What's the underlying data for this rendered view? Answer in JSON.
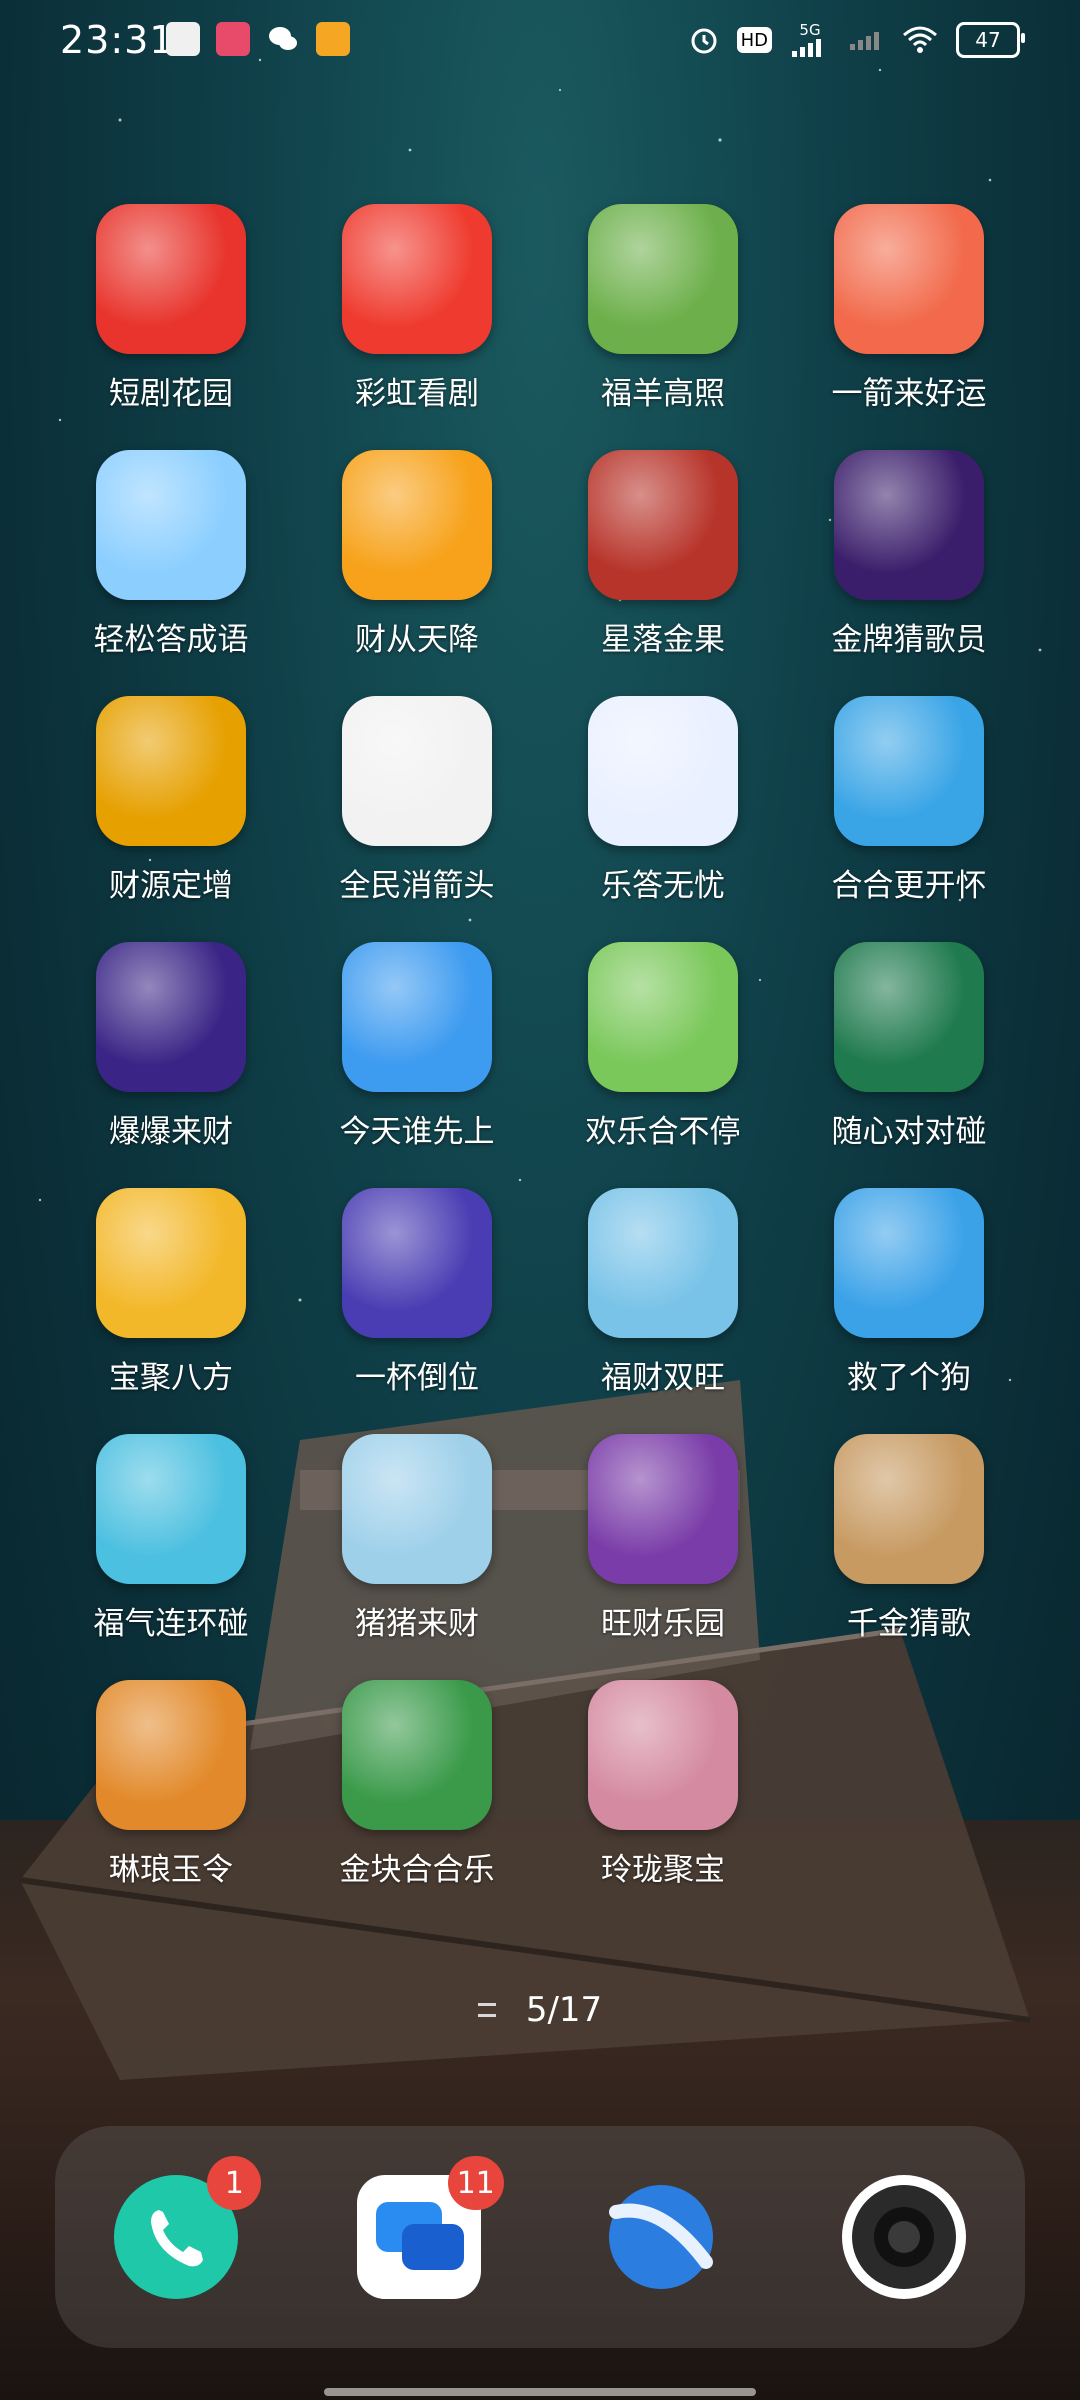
{
  "status_bar": {
    "time": "23:31",
    "battery": "47",
    "network": "5G",
    "hd": "HD"
  },
  "apps": [
    {
      "label": "短剧花园",
      "icon": "short-drama-tv-icon",
      "color": "#e8342c"
    },
    {
      "label": "彩虹看剧",
      "icon": "rainbow-drama-tv-icon",
      "color": "#ef3b2f"
    },
    {
      "label": "福羊高照",
      "icon": "sheep-icon",
      "color": "#6db04b"
    },
    {
      "label": "一箭来好运",
      "icon": "arrow-luck-icon",
      "color": "#f26a4b"
    },
    {
      "label": "轻松答成语",
      "icon": "student-icon",
      "color": "#8ccfff"
    },
    {
      "label": "财从天降",
      "icon": "tiger-icon",
      "color": "#f7a21a"
    },
    {
      "label": "星落金果",
      "icon": "old-man-icon",
      "color": "#b7342a"
    },
    {
      "label": "金牌猜歌员",
      "icon": "vinyl-record-icon",
      "color": "#3b1e6b"
    },
    {
      "label": "财源定增",
      "icon": "green-gem-icon",
      "color": "#e6a000"
    },
    {
      "label": "全民消箭头",
      "icon": "arrow-puzzle-icon",
      "color": "#f2f2f2"
    },
    {
      "label": "乐答无忧",
      "icon": "quiz-clipboard-icon",
      "color": "#e9f0ff"
    },
    {
      "label": "合合更开怀",
      "icon": "watermelon-icon",
      "color": "#3aa5e6"
    },
    {
      "label": "爆爆来财",
      "icon": "heart-balloon-icon",
      "color": "#3a2586"
    },
    {
      "label": "今天谁先上",
      "icon": "today-text-icon",
      "color": "#3d9bf0"
    },
    {
      "label": "欢乐合不停",
      "icon": "pineapple-icon",
      "color": "#7ac85a"
    },
    {
      "label": "随心对对碰",
      "icon": "fu-tiles-icon",
      "color": "#1f7a4e"
    },
    {
      "label": "宝聚八方",
      "icon": "panda-icon",
      "color": "#f3b82a"
    },
    {
      "label": "一杯倒位",
      "icon": "drink-cup-icon",
      "color": "#4a3db3"
    },
    {
      "label": "福财双旺",
      "icon": "jewel-watermelon-icon",
      "color": "#79c3e8"
    },
    {
      "label": "救了个狗",
      "icon": "shiba-dog-icon",
      "color": "#3ba2e8"
    },
    {
      "label": "福气连环碰",
      "icon": "watermelon-slice-icon",
      "color": "#4cc0e0"
    },
    {
      "label": "猪猪来财",
      "icon": "pig-icon",
      "color": "#9ed0ea"
    },
    {
      "label": "旺财乐园",
      "icon": "fruit-tomato-icon",
      "color": "#7a3ca8"
    },
    {
      "label": "千金猜歌",
      "icon": "dancer-girl-icon",
      "color": "#c79a62"
    },
    {
      "label": "琳琅玉令",
      "icon": "bearded-man-icon",
      "color": "#e28a2b"
    },
    {
      "label": "金块合合乐",
      "icon": "treasure-chest-icon",
      "color": "#3a9a4a"
    },
    {
      "label": "玲珑聚宝",
      "icon": "lady-icon",
      "color": "#d48aa0"
    }
  ],
  "pager": {
    "label": "5/17"
  },
  "dock": [
    {
      "name": "phone",
      "icon": "phone-icon",
      "badge": "1",
      "color": "#1ec8a8"
    },
    {
      "name": "messages",
      "icon": "messages-icon",
      "badge": "11",
      "color": "#2a8cf0"
    },
    {
      "name": "browser",
      "icon": "browser-planet-icon",
      "badge": "",
      "color": "#2b7de0"
    },
    {
      "name": "camera",
      "icon": "camera-icon",
      "badge": "",
      "color": "#2a2a2a"
    }
  ]
}
